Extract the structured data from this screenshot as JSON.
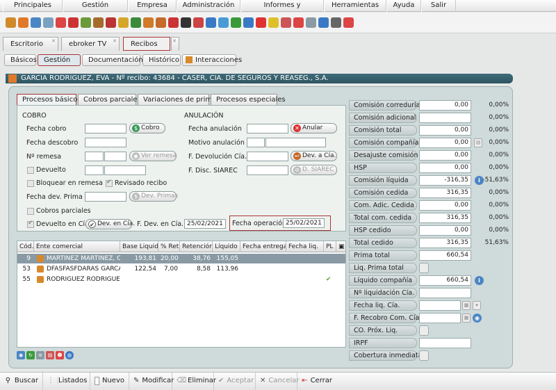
{
  "menu": [
    "Principales",
    "Gestión comercial",
    "Empresa",
    "Administración",
    "Informes y estadísticas",
    "Herramientas",
    "Ayuda",
    "Salir"
  ],
  "toolbar_icons": [
    {
      "name": "box-icon",
      "color": "#d08a2a"
    },
    {
      "name": "user-orange-icon",
      "color": "#e07a2a"
    },
    {
      "name": "user-blue-icon",
      "color": "#4a86c5"
    },
    {
      "name": "gear-user-icon",
      "color": "#7aa2c0"
    },
    {
      "name": "fire-icon",
      "color": "#d44"
    },
    {
      "name": "target-icon",
      "color": "#c33"
    },
    {
      "name": "pencil-icon",
      "color": "#6a9a3a"
    },
    {
      "name": "briefcase-icon",
      "color": "#a66a2a"
    },
    {
      "name": "chest-icon",
      "color": "#b33"
    },
    {
      "name": "stack-icon",
      "color": "#d4a62a"
    },
    {
      "name": "chart-icon",
      "color": "#3a8a3a"
    },
    {
      "name": "user-tie-icon",
      "color": "#d07a2a"
    },
    {
      "name": "people-icon",
      "color": "#c56a2a"
    },
    {
      "name": "flag-icon",
      "color": "#c33"
    },
    {
      "name": "ball-icon",
      "color": "#333"
    },
    {
      "name": "euro-icon",
      "color": "#c44"
    },
    {
      "name": "globe-icon",
      "color": "#3a7ac5"
    },
    {
      "name": "drop-icon",
      "color": "#4a9ad5"
    },
    {
      "name": "recycle-icon",
      "color": "#3a9a3a"
    },
    {
      "name": "power-icon",
      "color": "#3a7ac5"
    },
    {
      "name": "google-icon",
      "color": "#d33"
    },
    {
      "name": "bulb-icon",
      "color": "#e0c02a"
    },
    {
      "name": "document-red-icon",
      "color": "#c55"
    },
    {
      "name": "stamp-icon",
      "color": "#d44"
    },
    {
      "name": "notepad-icon",
      "color": "#8a9aa4"
    },
    {
      "name": "phone-icon",
      "color": "#3a7ac5"
    },
    {
      "name": "tools-icon",
      "color": "#666"
    },
    {
      "name": "help-icon",
      "color": "#d44"
    }
  ],
  "doc_tabs": [
    "Escritorio",
    "ebroker TV",
    "Recibos"
  ],
  "sub_tabs": [
    "Básicos",
    "Gestión",
    "Documentación",
    "Histórico",
    "Interacciones"
  ],
  "title": "GARCIA RODRIGUEZ, EVA - Nº recibo: 43684 - CASER, CIA. DE SEGUROS Y REASEG., S.A.",
  "inner_tabs": [
    "Procesos básicos",
    "Cobros parciales",
    "Variaciones de prima",
    "Procesos especiales"
  ],
  "form": {
    "cobro_title": "COBRO",
    "anulacion_title": "ANULACIÓN",
    "fecha_cobro": "Fecha cobro",
    "cobro_btn": "Cobro",
    "fecha_descobro": "Fecha descobro",
    "num_remesa": "Nº remesa",
    "ver_remesa_btn": "Ver remesa",
    "devuelto": "Devuelto",
    "bloquear_remesa": "Bloquear en remesa",
    "revisado_recibo": "Revisado recibo",
    "fecha_dev_prima": "Fecha dev. Prima",
    "dev_primas_btn": "Dev. Primas",
    "cobros_parciales": "Cobros parciales",
    "devuelto_cia": "Devuelto en Cía.",
    "dev_en_cia_btn": "Dev. en Cía.",
    "f_dev_en_cia": "F. Dev. en Cía.",
    "f_dev_en_cia_value": "25/02/2021",
    "fecha_operacion": "Fecha operación",
    "fecha_operacion_value": "25/02/2021",
    "fecha_anulacion": "Fecha anulación",
    "anular_btn": "Anular",
    "motivo_anulacion": "Motivo anulación",
    "f_devolucion_cia": "F. Devolución Cía.",
    "dev_a_cia_btn": "Dev. a Cía.",
    "f_disc_siarec": "F. Disc. SIAREC",
    "d_siarec_btn": "D. SIAREC"
  },
  "grid": {
    "headers": [
      "Cód.",
      "Ente comercial",
      "Base Liquid.",
      "% Ret.",
      "Retención",
      "Líquido",
      "Fecha entrega",
      "Fecha liq.",
      "PL"
    ],
    "rows": [
      {
        "cod": "9",
        "ente": "MARTINEZ MARTINEZ, CA",
        "base": "193,81",
        "ret_pct": "20,00",
        "retencion": "38,76",
        "liquido": "155,05",
        "pl": ""
      },
      {
        "cod": "53",
        "ente": "DFASFASFDARAS GARCAI",
        "base": "122,54",
        "ret_pct": "7,00",
        "retencion": "8,58",
        "liquido": "113,96",
        "pl": ""
      },
      {
        "cod": "55",
        "ente": "RODRIGUEZ RODRIGUEZ,",
        "base": "",
        "ret_pct": "",
        "retencion": "",
        "liquido": "",
        "pl": "✔"
      }
    ]
  },
  "right": [
    {
      "label": "Comisión correduría",
      "value": "0,00",
      "pct": "0,00%"
    },
    {
      "label": "Comisión adicional",
      "value": "",
      "pct": "0,00%"
    },
    {
      "label": "Comisión total",
      "value": "0,00",
      "pct": "0,00%"
    },
    {
      "label": "Comisión compañía",
      "value": "0,00",
      "pct": "0,00%"
    },
    {
      "label": "Desajuste comisión",
      "value": "0,00",
      "pct": "0,00%"
    },
    {
      "label": "HSP",
      "value": "0,00",
      "pct": "0,00%"
    },
    {
      "label": "Comisión líquida",
      "value": "-316,35",
      "pct": "-51,63%"
    },
    {
      "label": "Comisión cedida",
      "value": "316,35",
      "pct": "0,00%"
    },
    {
      "label": "Com. Adic. Cedida",
      "value": "0,00",
      "pct": "0,00%"
    },
    {
      "label": "Total com. cedida",
      "value": "316,35",
      "pct": "0,00%"
    },
    {
      "label": "HSP cedido",
      "value": "0,00",
      "pct": "0,00%"
    },
    {
      "label": "Total cedido",
      "value": "316,35",
      "pct": "51,63%"
    },
    {
      "label": "Prima total",
      "value": "660,54",
      "pct": ""
    },
    {
      "label": "Liq. Prima total",
      "value": "",
      "pct": ""
    },
    {
      "label": "Líquido compañía",
      "value": "660,54",
      "pct": ""
    },
    {
      "label": "Nº liquidación Cía.",
      "value": "",
      "pct": ""
    },
    {
      "label": "Fecha liq. Cía.",
      "value": "",
      "pct": ""
    },
    {
      "label": "F. Recobro Com. Cía.",
      "value": "",
      "pct": ""
    },
    {
      "label": "CO. Próx. Liq.",
      "value": "",
      "pct": ""
    },
    {
      "label": "IRPF",
      "value": "",
      "pct": ""
    },
    {
      "label": "Cobertura inmediata",
      "value": "",
      "pct": ""
    }
  ],
  "bottom": [
    "Buscar",
    "Listados",
    "Nuevo",
    "Modificar",
    "Eliminar",
    "Aceptar",
    "Cancelar",
    "Cerrar"
  ]
}
